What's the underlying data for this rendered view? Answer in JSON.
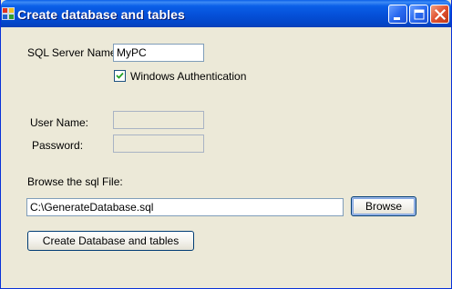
{
  "window": {
    "title": "Create database and tables",
    "app_icon": "database-app-icon",
    "caption_buttons": [
      "minimize-icon",
      "maximize-icon",
      "close-icon"
    ]
  },
  "form": {
    "server_label": "SQL Server Name:",
    "server_value": "MyPC",
    "windows_auth_label": "Windows Authentication",
    "windows_auth_checked": true,
    "username_label": "User Name:",
    "username_value": "",
    "password_label": "Password:",
    "password_value": "",
    "browse_label": "Browse the sql File:",
    "file_path": "C:\\GenerateDatabase.sql",
    "browse_button": "Browse",
    "create_button": "Create Database and tables"
  },
  "colors": {
    "titlebar": "#0a5fe8",
    "client_background": "#ece9d8",
    "button_border": "#003c74",
    "close_button": "#e05030"
  }
}
